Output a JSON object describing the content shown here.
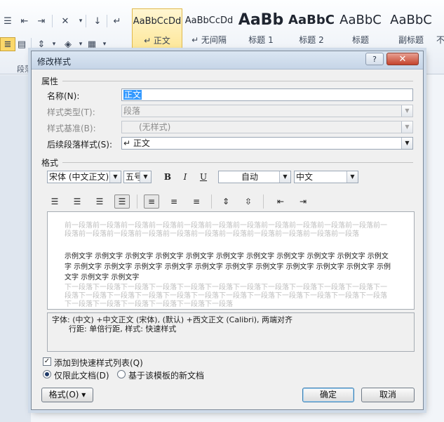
{
  "ribbon": {
    "group_label": "段落",
    "styles": [
      {
        "sample": "AaBbCcDd",
        "label": "↵ 正文"
      },
      {
        "sample": "AaBbCcDd",
        "label": "↵ 无间隔"
      },
      {
        "sample": "AaBb",
        "label": "标题 1"
      },
      {
        "sample": "AaBbC",
        "label": "标题 2"
      },
      {
        "sample": "AaBbC",
        "label": "标题"
      },
      {
        "sample": "AaBbC",
        "label": "副标题"
      },
      {
        "sample": "",
        "label": "不"
      }
    ]
  },
  "dialog": {
    "title": "修改样式",
    "help_label": "?",
    "close_label": "✕",
    "properties": {
      "section": "属性",
      "name_label": "名称(N):",
      "name_value": "正文",
      "type_label": "样式类型(T):",
      "type_value": "段落",
      "based_label": "样式基准(B):",
      "based_value": "(无样式)",
      "next_label": "后续段落样式(S):",
      "next_value": "↵ 正文"
    },
    "format": {
      "section": "格式",
      "font": "宋体 (中文正文)",
      "size": "五号",
      "bold": "B",
      "italic": "I",
      "underline": "U",
      "color": "自动",
      "language": "中文"
    },
    "preview": {
      "prev_text": "前一段落前一段落前一段落前一段落前一段落前一段落前一段落前一段落前一段落前一段落前一段落前一段落前一段落前一段落前一段落前一段落前一段落前一段落前一段落前一段落前一段落前一段落",
      "sample_text": "示例文字 示例文字 示例文字 示例文字 示例文字 示例文字 示例文字 示例文字 示例文字 示例文字 示例文字 示例文字 示例文字 示例文字 示例文字 示例文字 示例文字 示例文字 示例文字 示例文字 示例文字 示例文字 示例文字 示例文字",
      "next_text": "下一段落下一段落下一段落下一段落下一段落下一段落下一段落下一段落下一段落下一段落下一段落下一段落下一段落下一段落下一段落下一段落下一段落下一段落下一段落下一段落下一段落下一段落下一段落下一段落下一段落下一段落下一段落下一段落下一段落"
    },
    "description": {
      "line1": "字体: (中文) +中文正文 (宋体), (默认) +西文正文 (Calibri), 两端对齐",
      "line2": "行距: 单倍行距, 样式: 快速样式"
    },
    "options": {
      "add_quick_style": "添加到快速样式列表(Q)",
      "add_quick_style_checked": "✓",
      "only_this_doc": "仅限此文档(D)",
      "new_docs_template": "基于该模板的新文档"
    },
    "buttons": {
      "format_menu": "格式(O) ▾",
      "ok": "确定",
      "cancel": "取消"
    }
  }
}
